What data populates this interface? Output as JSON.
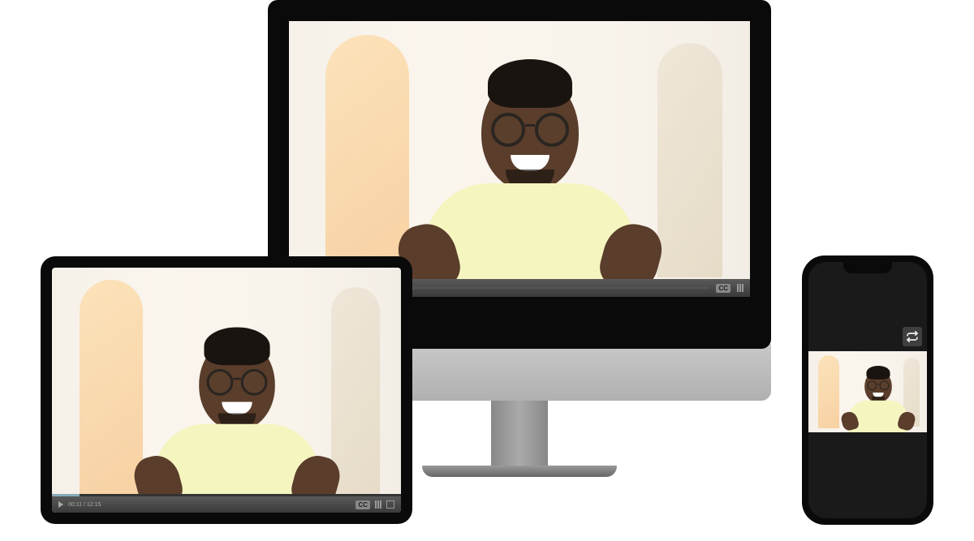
{
  "tablet": {
    "player": {
      "time_display": "00:11 / 12:15",
      "cc_label": "CC"
    }
  },
  "monitor": {
    "player": {
      "cc_label": "CC"
    }
  },
  "phone": {
    "repeat_icon_name": "repeat"
  },
  "colors": {
    "device_bezel": "#0a0a0a",
    "control_bar": "#3a3a3a",
    "shirt": "#f5f5c0"
  }
}
